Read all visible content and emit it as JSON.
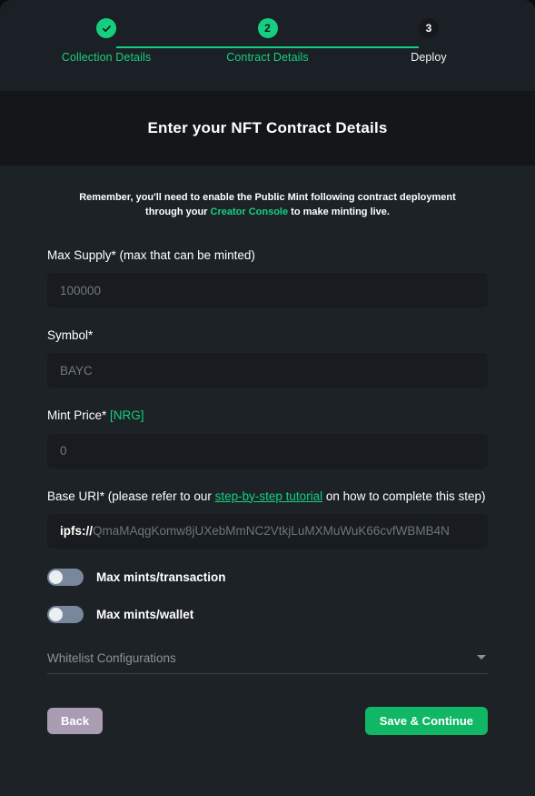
{
  "stepper": {
    "steps": [
      {
        "marker": "check",
        "label": "Collection Details",
        "state": "done"
      },
      {
        "marker": "2",
        "label": "Contract Details",
        "state": "active"
      },
      {
        "marker": "3",
        "label": "Deploy",
        "state": "todo"
      }
    ],
    "accent_color": "#15cf7f"
  },
  "header": {
    "title": "Enter your NFT Contract Details"
  },
  "notice": {
    "text_before": "Remember, you'll need to enable the Public Mint following contract deployment through your ",
    "link_label": "Creator Console",
    "text_after": " to make minting live."
  },
  "form": {
    "max_supply": {
      "label": "Max Supply* (max that can be minted)",
      "placeholder": "100000",
      "value": ""
    },
    "symbol": {
      "label": "Symbol*",
      "placeholder": "BAYC",
      "value": ""
    },
    "mint_price": {
      "label": "Mint Price*",
      "currency": "[NRG]",
      "placeholder": "0",
      "value": ""
    },
    "base_uri": {
      "label_before": "Base URI* (please refer to our ",
      "label_link": "step-by-step tutorial",
      "label_after": " on how to complete this step)",
      "prefix": "ipfs://",
      "placeholder": "QmaMAqgKomw8jUXebMmNC2VtkjLuMXMuWuK66cvfWBMB4N",
      "value": ""
    },
    "toggles": [
      {
        "label": "Max mints/transaction",
        "enabled": false
      },
      {
        "label": "Max mints/wallet",
        "enabled": false
      }
    ],
    "whitelist": {
      "placeholder": "Whitelist Configurations",
      "selected": "Whitelist Configurations"
    }
  },
  "footer": {
    "back_label": "Back",
    "save_label": "Save & Continue",
    "back_color": "#a99cb3",
    "save_color": "#10b765"
  }
}
